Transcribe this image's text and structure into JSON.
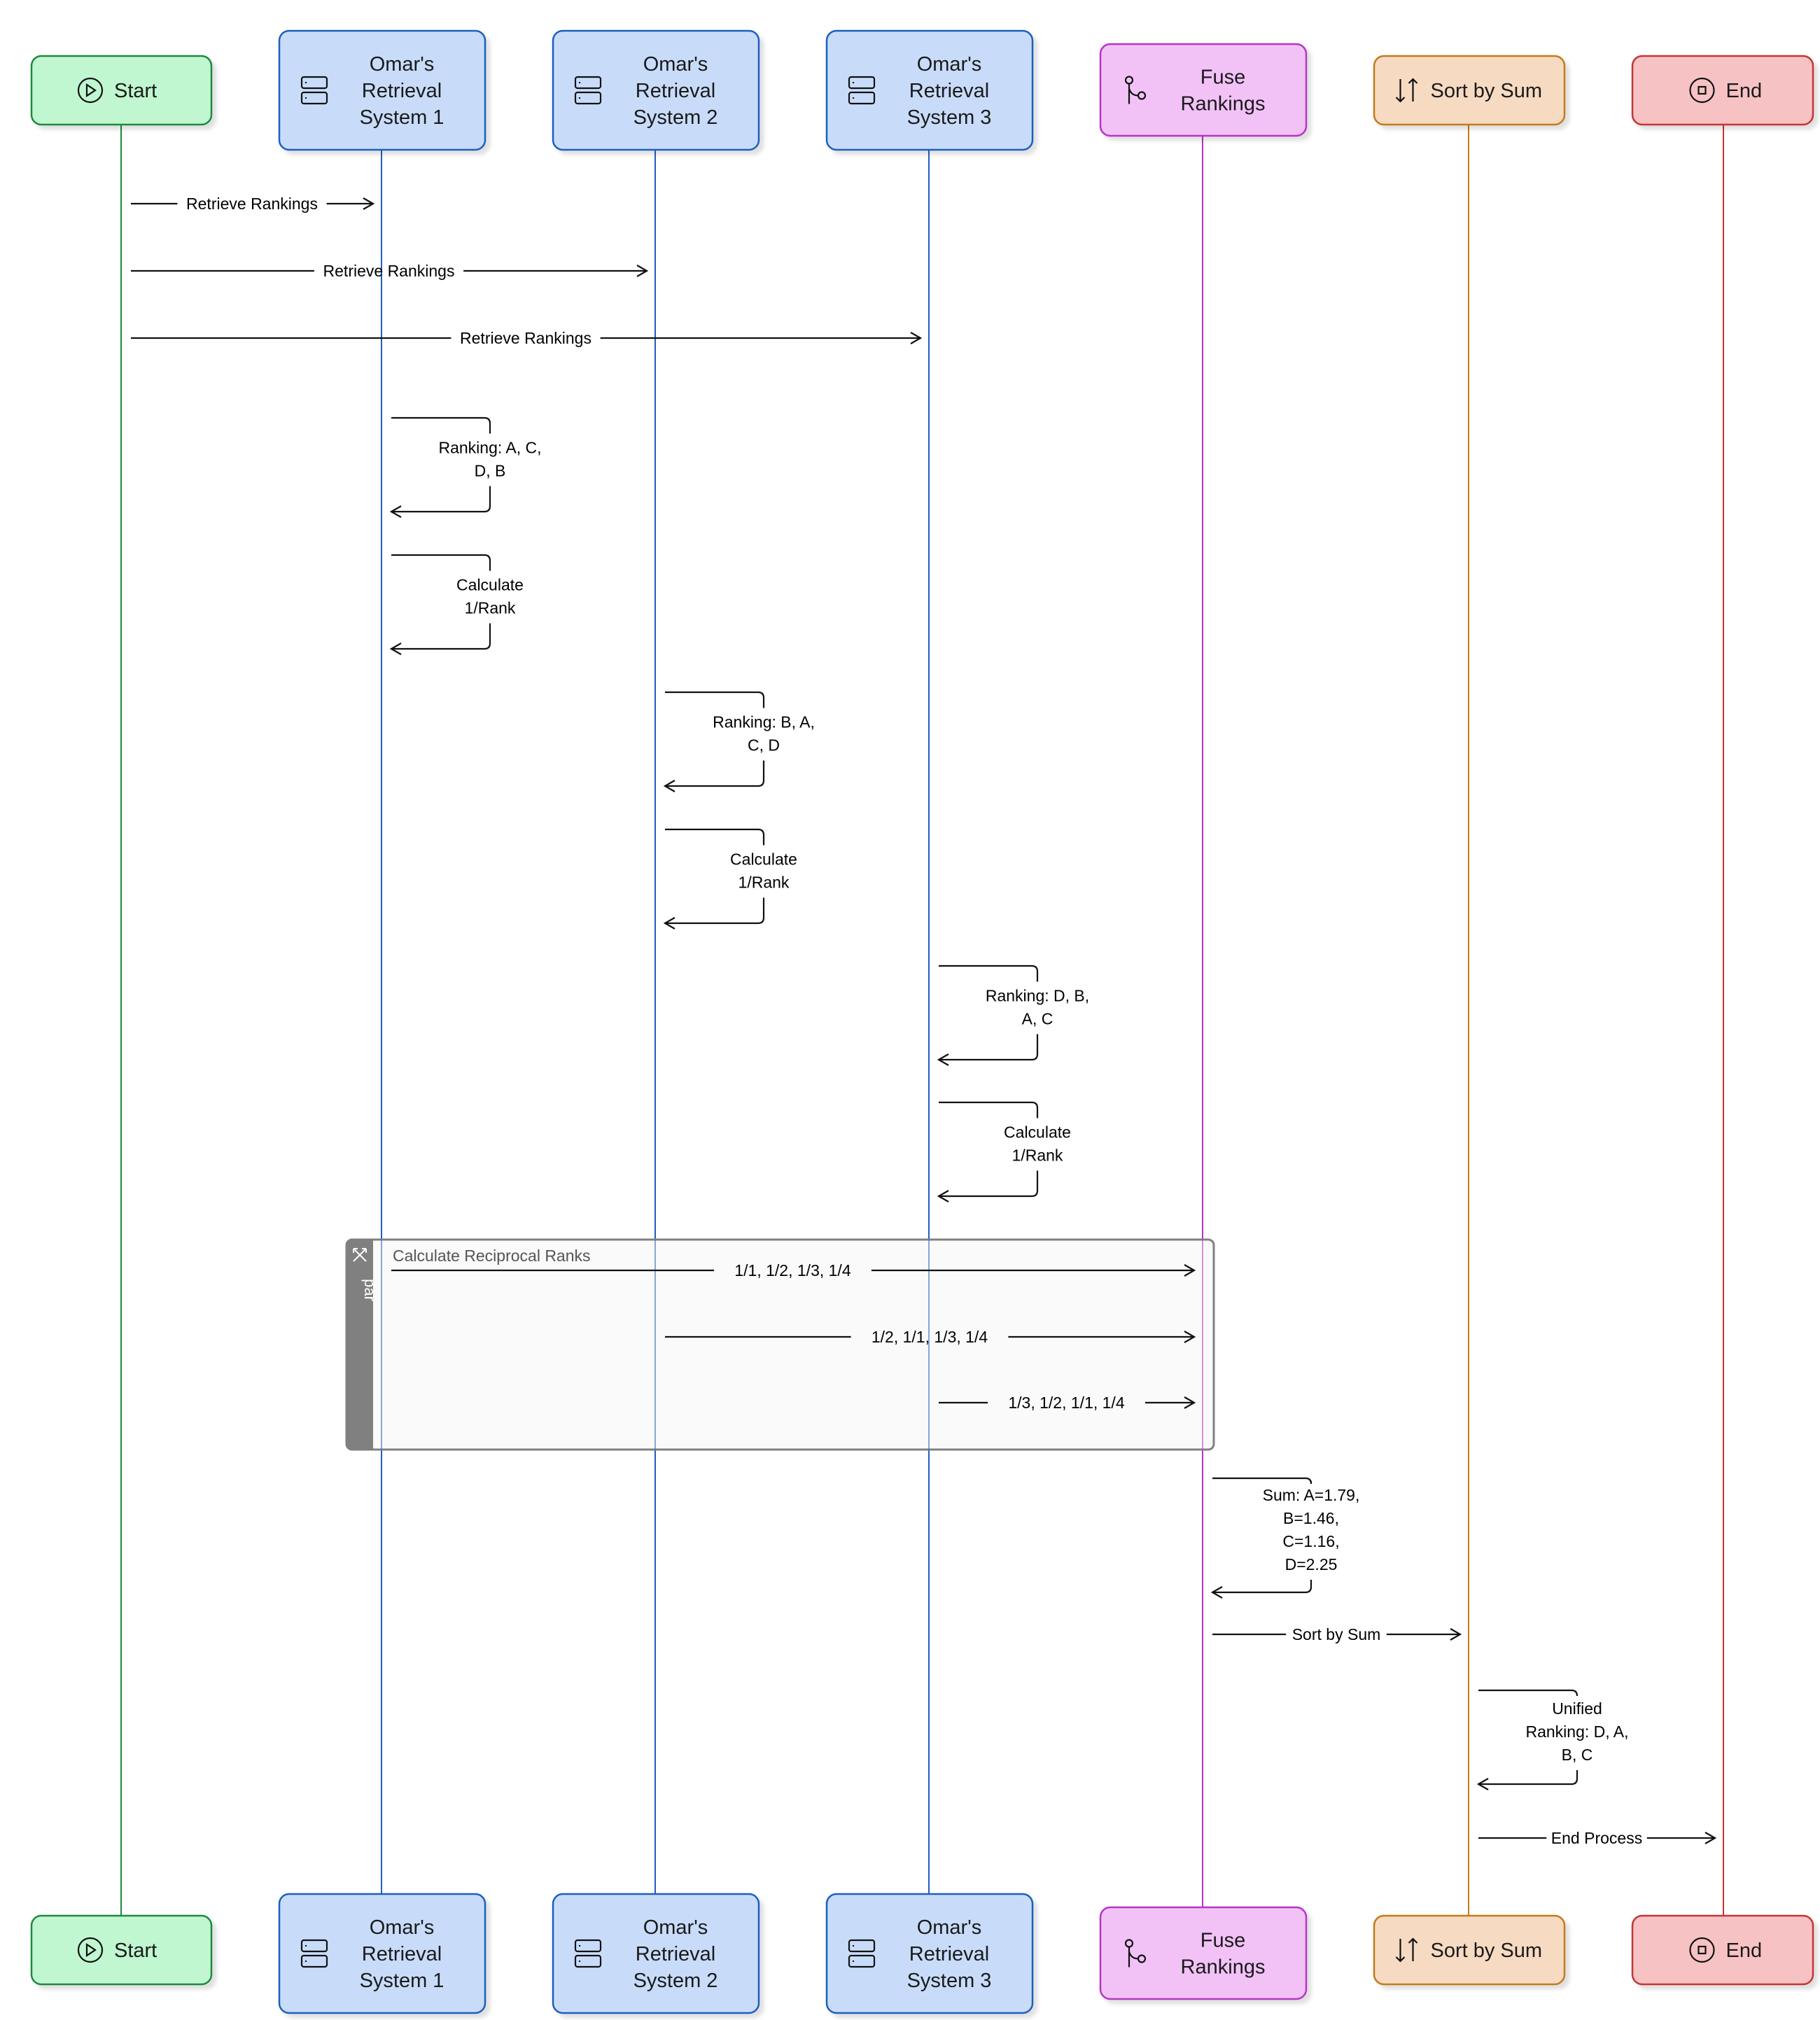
{
  "diagram": {
    "type": "sequence",
    "participants": [
      {
        "id": "start",
        "label": [
          "Start"
        ],
        "icon": "play-circle-icon",
        "fill": "#c0f7d0",
        "stroke": "#1e8a3c"
      },
      {
        "id": "sys1",
        "label": [
          "Omar's",
          "Retrieval",
          "System 1"
        ],
        "icon": "server-icon",
        "fill": "#c8dcfa",
        "stroke": "#1f5fbf"
      },
      {
        "id": "sys2",
        "label": [
          "Omar's",
          "Retrieval",
          "System 2"
        ],
        "icon": "server-icon",
        "fill": "#c8dcfa",
        "stroke": "#1f5fbf"
      },
      {
        "id": "sys3",
        "label": [
          "Omar's",
          "Retrieval",
          "System 3"
        ],
        "icon": "server-icon",
        "fill": "#c8dcfa",
        "stroke": "#1f5fbf"
      },
      {
        "id": "fuse",
        "label": [
          "Fuse",
          "Rankings"
        ],
        "icon": "merge-icon",
        "fill": "#f2c2f7",
        "stroke": "#b534c4"
      },
      {
        "id": "sort",
        "label": [
          "Sort by Sum"
        ],
        "icon": "sort-arrows-icon",
        "fill": "#f7dac2",
        "stroke": "#c47a1a"
      },
      {
        "id": "end",
        "label": [
          "End"
        ],
        "icon": "stop-circle-icon",
        "fill": "#f7c2c4",
        "stroke": "#c43434"
      }
    ],
    "messages": [
      {
        "from": "start",
        "to": "sys1",
        "label": [
          "Retrieve Rankings"
        ]
      },
      {
        "from": "start",
        "to": "sys2",
        "label": [
          "Retrieve Rankings"
        ]
      },
      {
        "from": "start",
        "to": "sys3",
        "label": [
          "Retrieve Rankings"
        ]
      },
      {
        "from": "sys1",
        "to": "sys1",
        "label": [
          "Ranking: A, C,",
          "D, B"
        ]
      },
      {
        "from": "sys1",
        "to": "sys1",
        "label": [
          "Calculate",
          "1/Rank"
        ]
      },
      {
        "from": "sys2",
        "to": "sys2",
        "label": [
          "Ranking: B, A,",
          "C, D"
        ]
      },
      {
        "from": "sys2",
        "to": "sys2",
        "label": [
          "Calculate",
          "1/Rank"
        ]
      },
      {
        "from": "sys3",
        "to": "sys3",
        "label": [
          "Ranking: D, B,",
          "A, C"
        ]
      },
      {
        "from": "sys3",
        "to": "sys3",
        "label": [
          "Calculate",
          "1/Rank"
        ]
      },
      {
        "from": "sys1",
        "to": "fuse",
        "label": [
          "1/1, 1/2, 1/3, 1/4"
        ]
      },
      {
        "from": "sys2",
        "to": "fuse",
        "label": [
          "1/2, 1/1, 1/3, 1/4"
        ]
      },
      {
        "from": "sys3",
        "to": "fuse",
        "label": [
          "1/3, 1/2, 1/1, 1/4"
        ]
      },
      {
        "from": "fuse",
        "to": "fuse",
        "label": [
          "Sum: A=1.79,",
          "B=1.46,",
          "C=1.16,",
          "D=2.25"
        ]
      },
      {
        "from": "fuse",
        "to": "sort",
        "label": [
          "Sort by Sum"
        ]
      },
      {
        "from": "sort",
        "to": "sort",
        "label": [
          "Unified",
          "Ranking: D, A,",
          "B, C"
        ]
      },
      {
        "from": "sort",
        "to": "end",
        "label": [
          "End Process"
        ]
      }
    ],
    "fragment": {
      "kind": "par",
      "title": "Calculate Reciprocal Ranks",
      "icon": "parallel-arrows-icon",
      "messages": [
        9,
        10,
        11
      ]
    }
  }
}
